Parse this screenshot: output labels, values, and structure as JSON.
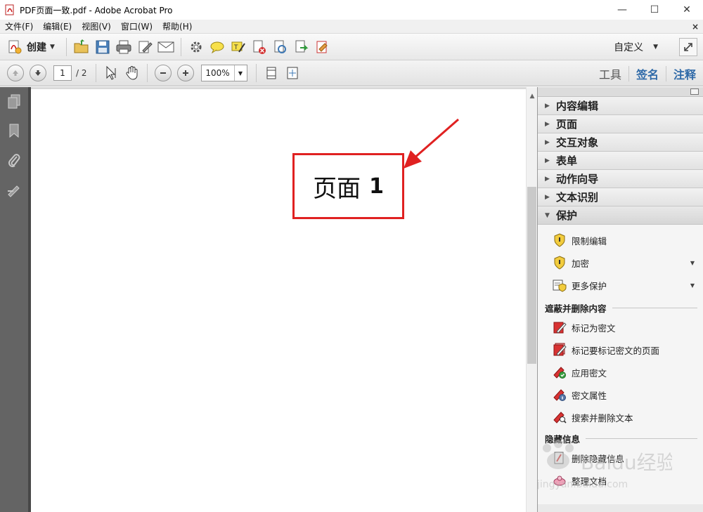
{
  "window": {
    "title": "PDF页面一致.pdf - Adobe Acrobat Pro",
    "minimize": "—",
    "maximize": "☐",
    "close": "✕"
  },
  "menu": {
    "items": [
      "文件(F)",
      "编辑(E)",
      "视图(V)",
      "窗口(W)",
      "帮助(H)"
    ],
    "close_glyph": "×"
  },
  "toolbar": {
    "create_label": "创建",
    "customize_label": "自定义",
    "icons": [
      "open-folder-icon",
      "save-icon",
      "print-icon",
      "edit-icon",
      "email-icon",
      "settings-icon",
      "comment-icon",
      "highlight-icon",
      "delete-page-icon",
      "extract-icon",
      "export-icon",
      "sign-icon"
    ]
  },
  "nav": {
    "page_current": "1",
    "page_total": "/ 2",
    "zoom": "100%"
  },
  "right_tabs": [
    "工具",
    "签名",
    "注释"
  ],
  "document": {
    "page_text": "页面",
    "page_number": "1"
  },
  "panel": {
    "sections": [
      "内容编辑",
      "页面",
      "交互对象",
      "表单",
      "动作向导",
      "文本识别",
      "保护"
    ],
    "protect_items": [
      {
        "label": "限制编辑",
        "dropdown": false
      },
      {
        "label": "加密",
        "dropdown": true
      },
      {
        "label": "更多保护",
        "dropdown": true
      }
    ],
    "group_redact": "遮蔽并删除内容",
    "redact_items": [
      "标记为密文",
      "标记要标记密文的页面",
      "应用密文",
      "密文属性",
      "搜索并删除文本"
    ],
    "group_hidden": "隐藏信息",
    "hidden_items": [
      "删除隐藏信息",
      "整理文档"
    ]
  },
  "watermark": {
    "text": "Baidu经验",
    "sub": "jingyan.baidu.com"
  },
  "colors": {
    "accent_red": "#e02121",
    "tab_blue": "#2f6aa8",
    "left_pane": "#646464"
  }
}
